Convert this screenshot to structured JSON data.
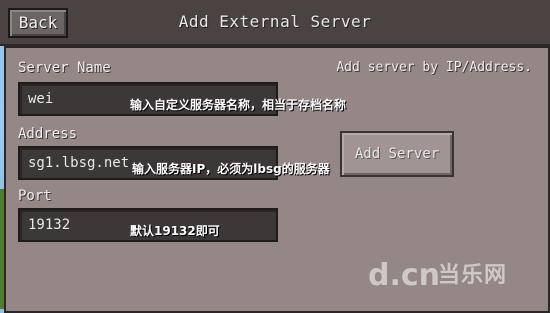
{
  "header": {
    "back_label": "Back",
    "title": "Add External Server"
  },
  "form": {
    "hint": "Add server by IP/Address.",
    "server_name_label": "Server Name",
    "server_name_value": "wei",
    "server_name_note": "输入自定义服务器名称，相当于存档名称",
    "address_label": "Address",
    "address_value": "sg1.lbsg.net",
    "address_note": "输入服务器IP，必须为lbsg的服务器",
    "port_label": "Port",
    "port_value": "19132",
    "port_note": "默认19132即可",
    "add_button_label": "Add Server"
  },
  "watermark": {
    "logo": "d.cn",
    "text": "当乐网"
  }
}
